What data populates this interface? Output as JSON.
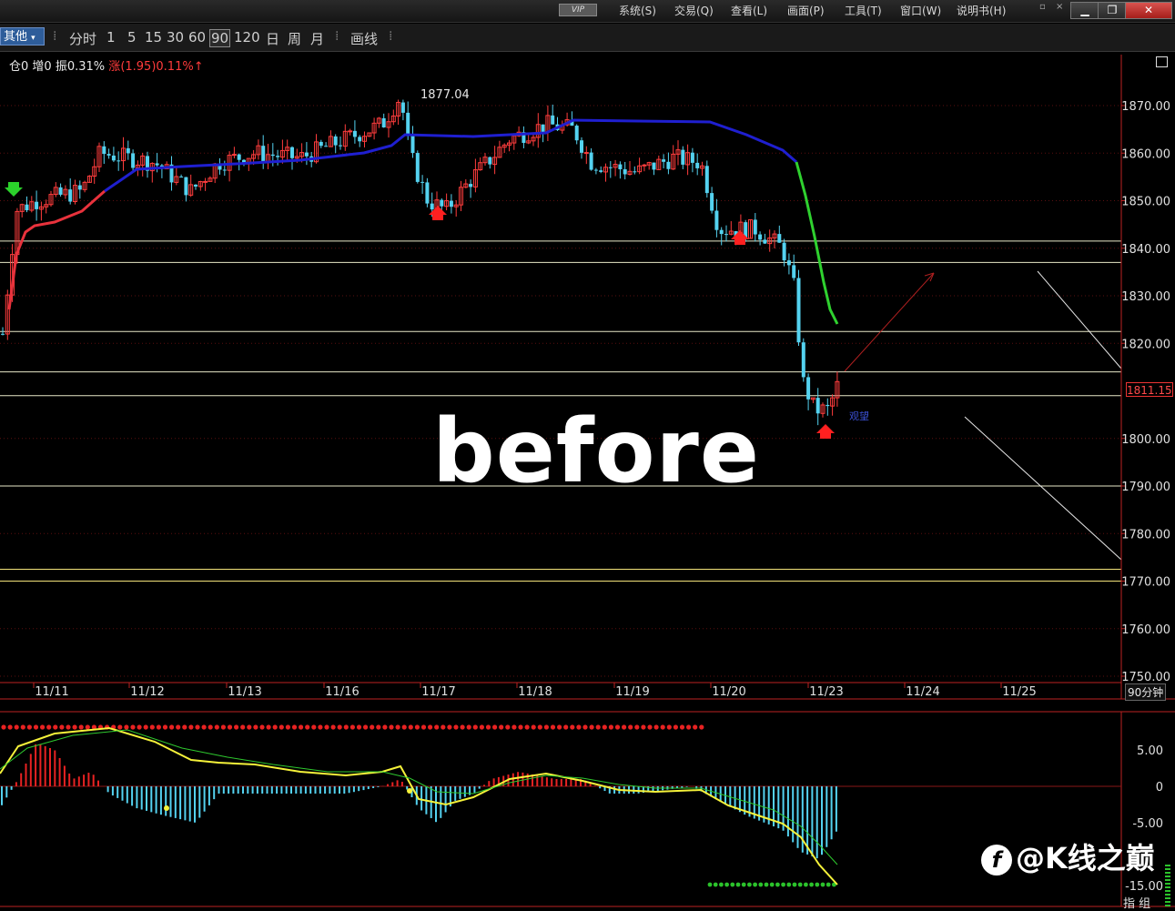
{
  "menu": {
    "vip": "VIP",
    "items": [
      "系统(S)",
      "交易(Q)",
      "查看(L)",
      "画面(P)",
      "工具(T)",
      "窗口(W)",
      "说明书(H)"
    ]
  },
  "toolbar": {
    "period_select": "其他",
    "fenshi": "分时",
    "periods": [
      "1",
      "5",
      "15",
      "30",
      "60",
      "90",
      "120",
      "日",
      "周",
      "月"
    ],
    "active_period": "90",
    "draw": "画线"
  },
  "info": {
    "position": "仓0",
    "increase": "增0",
    "amplitude": "振0.31%",
    "change_prefix": "涨",
    "change_value": "(1.95)0.11%↑"
  },
  "annotations": {
    "high_price": "1877.04",
    "current_price": "1811.15",
    "observe": "观望",
    "watermark": "before",
    "brand": "@K线之巅"
  },
  "labels": {
    "period_tag": "90分钟",
    "indicator_tag": "指 组"
  },
  "chart_data": [
    {
      "type": "candlestick",
      "title": "",
      "x_labels": [
        "11/11",
        "11/12",
        "11/13",
        "11/16",
        "11/17",
        "11/18",
        "11/19",
        "11/20",
        "11/23",
        "11/24",
        "11/25"
      ],
      "y_ticks": [
        "1870.00",
        "1860.00",
        "1850.00",
        "1840.00",
        "1830.00",
        "1820.00",
        "1800.00",
        "1790.00",
        "1780.00",
        "1770.00",
        "1760.00",
        "1750.00"
      ],
      "ylim": [
        1750,
        1877
      ],
      "high_marker": 1877.04,
      "last_price": 1811.15,
      "horizontal_levels": [
        1841.5,
        1837,
        1822.5,
        1814,
        1809,
        1790,
        1772.5,
        1770
      ],
      "trend_line_colors": {
        "up": "#e8323c",
        "blue": "#1f1fd0",
        "down": "#2fd12f"
      },
      "candles_approx": [
        {
          "x": "11/11",
          "close": 1846
        },
        {
          "x": "11/12",
          "close": 1861
        },
        {
          "x": "11/13",
          "close": 1858
        },
        {
          "x": "11/16",
          "close": 1862
        },
        {
          "x": "11/16b",
          "close": 1872
        },
        {
          "x": "11/17",
          "close": 1849
        },
        {
          "x": "11/18",
          "close": 1868
        },
        {
          "x": "11/19",
          "close": 1858
        },
        {
          "x": "11/20",
          "close": 1845
        },
        {
          "x": "11/23a",
          "close": 1804
        },
        {
          "x": "11/23",
          "close": 1811
        }
      ]
    },
    {
      "type": "macd",
      "y_ticks": [
        "5.00",
        "0",
        "-5.00",
        "-15.00"
      ],
      "ylim": [
        -15,
        8
      ]
    }
  ]
}
